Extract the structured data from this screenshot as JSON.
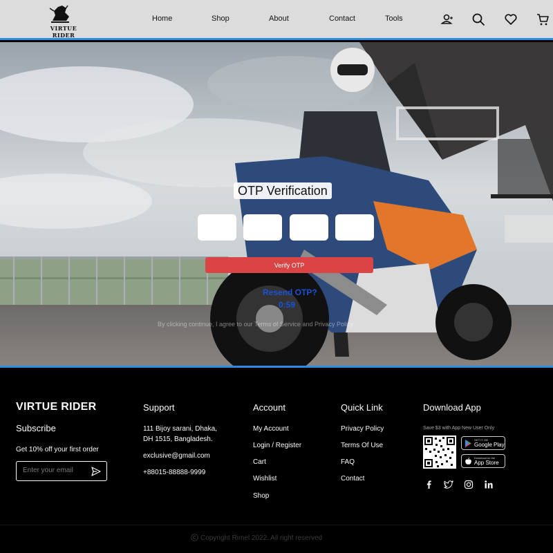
{
  "header": {
    "logo_text": "VIRTUE RIDER",
    "nav": [
      "Home",
      "Shop",
      "About",
      "Contact",
      "Tools"
    ],
    "icons": [
      "account-icon",
      "search-icon",
      "heart-icon",
      "cart-icon"
    ]
  },
  "otp": {
    "title": "OTP Verification",
    "button_label": "Verify OTP",
    "resend_text": "Resend OTP?",
    "timer": "0:59",
    "terms_text": "By clicking continue, I agree to our Terms of Service and Privacy Policy",
    "accent_color": "#db4444",
    "link_color": "#1a52d6"
  },
  "footer": {
    "brand": "VIRTUE RIDER",
    "subscribe_title": "Subscribe",
    "subscribe_text": "Get 10% off your first order",
    "email_placeholder": "Enter your email",
    "support": {
      "title": "Support",
      "address_line1": "111 Bijoy sarani, Dhaka,",
      "address_line2": "DH 1515, Bangladesh.",
      "email": "exclusive@gmail.com",
      "phone": "+88015-88888-9999"
    },
    "account": {
      "title": "Account",
      "links": [
        "My Account",
        "Login / Register",
        "Cart",
        "Wishlist",
        "Shop"
      ]
    },
    "quick_link": {
      "title": "Quick Link",
      "links": [
        "Privacy Policy",
        "Terms Of Use",
        "FAQ",
        "Contact"
      ]
    },
    "download": {
      "title": "Download App",
      "promo": "Save $3 with App New User Only",
      "google_small": "GET IT ON",
      "google_big": "Google Play",
      "apple_small": "Download on the",
      "apple_big": "App Store"
    },
    "social_icons": [
      "facebook-icon",
      "twitter-icon",
      "instagram-icon",
      "linkedin-icon"
    ],
    "copyright": "Copyright Rimel 2022. All right reserved"
  }
}
